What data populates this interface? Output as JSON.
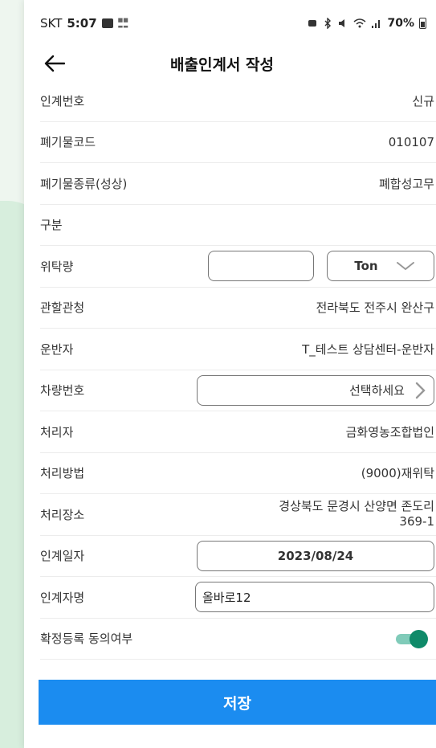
{
  "status_bar": {
    "carrier": "SKT",
    "time": "5:07",
    "battery": "70%",
    "signal_text": "≈.ıl"
  },
  "header": {
    "back_icon": "arrow-left-icon",
    "title": "배출인계서 작성"
  },
  "form": {
    "handover_no": {
      "label": "인계번호",
      "value": "신규"
    },
    "waste_code": {
      "label": "폐기물코드",
      "value": "010107"
    },
    "waste_type": {
      "label": "폐기물종류(성상)",
      "value": "폐합성고무"
    },
    "category": {
      "label": "구분",
      "value": ""
    },
    "quantity": {
      "label": "위탁량",
      "value": "",
      "unit": "Ton"
    },
    "authority": {
      "label": "관할관청",
      "value": "전라북도 전주시 완산구"
    },
    "transporter": {
      "label": "운반자",
      "value": "T_테스트 상담센터-운반자"
    },
    "vehicle_no": {
      "label": "차량번호",
      "value": "선택하세요"
    },
    "processor": {
      "label": "처리자",
      "value": "금화영농조합법인"
    },
    "method": {
      "label": "처리방법",
      "value": "(9000)재위탁"
    },
    "location": {
      "label": "처리장소",
      "value_line1": "경상북도 문경시 산양면 존도리",
      "value_line2": "369-1"
    },
    "handover_date": {
      "label": "인계일자",
      "value": "2023/08/24"
    },
    "handover_name": {
      "label": "인계자명",
      "value": "올바로12"
    },
    "consent": {
      "label": "확정등록 동의여부",
      "checked": true
    }
  },
  "save_button": {
    "label": "저장"
  },
  "colors": {
    "accent": "#1b8cf0",
    "toggle": "#0f8a69"
  }
}
